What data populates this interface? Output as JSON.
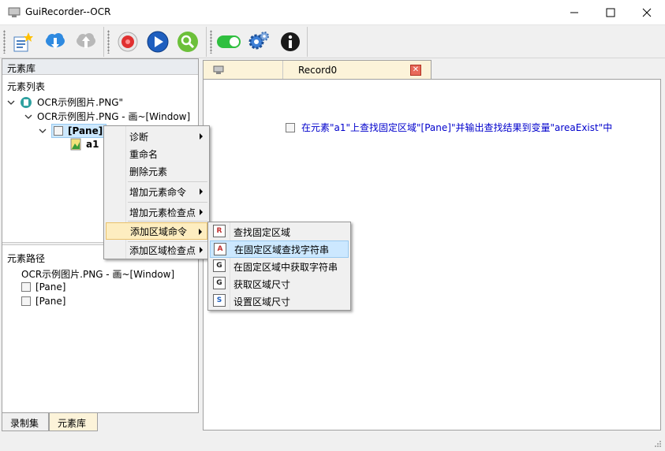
{
  "window": {
    "title": "GuiRecorder--OCR",
    "minimize": "—",
    "maximize": "☐",
    "close": "✕"
  },
  "toolbar": {
    "icons": [
      "new-project-icon",
      "cloud-download-icon",
      "cloud-upload-icon",
      "record-icon",
      "play-icon",
      "find-icon",
      "toggle-icon",
      "settings-icon",
      "info-icon"
    ]
  },
  "left_panel": {
    "header": "元素库",
    "tree_label": "元素列表",
    "tree": {
      "root": "OCR示例图片.PNG\"",
      "window": "OCR示例图片.PNG - 画~[Window]",
      "pane": "[Pane]",
      "leaf": "a1"
    },
    "path_label": "元素路径",
    "path": {
      "window": "OCR示例图片.PNG - 画~[Window]",
      "pane1": "[Pane]",
      "pane2": "[Pane]"
    }
  },
  "bottom_tabs": [
    "录制集",
    "元素库"
  ],
  "document": {
    "tab_title": "Record0",
    "tab_close": "✕",
    "record_line": "在元素\"a1\"上查找固定区域\"[Pane]\"并输出查找结果到变量\"areaExist\"中"
  },
  "context_menu": {
    "items": [
      "诊断",
      "重命名",
      "删除元素",
      "增加元素命令",
      "增加元素检查点",
      "添加区域命令",
      "添加区域检查点"
    ]
  },
  "submenu": {
    "items": [
      {
        "label": "查找固定区域",
        "icon": "R"
      },
      {
        "label": "在固定区域查找字符串",
        "icon": "A"
      },
      {
        "label": "在固定区域中获取字符串",
        "icon": "G"
      },
      {
        "label": "获取区域尺寸",
        "icon": "G"
      },
      {
        "label": "设置区域尺寸",
        "icon": "S"
      }
    ]
  }
}
